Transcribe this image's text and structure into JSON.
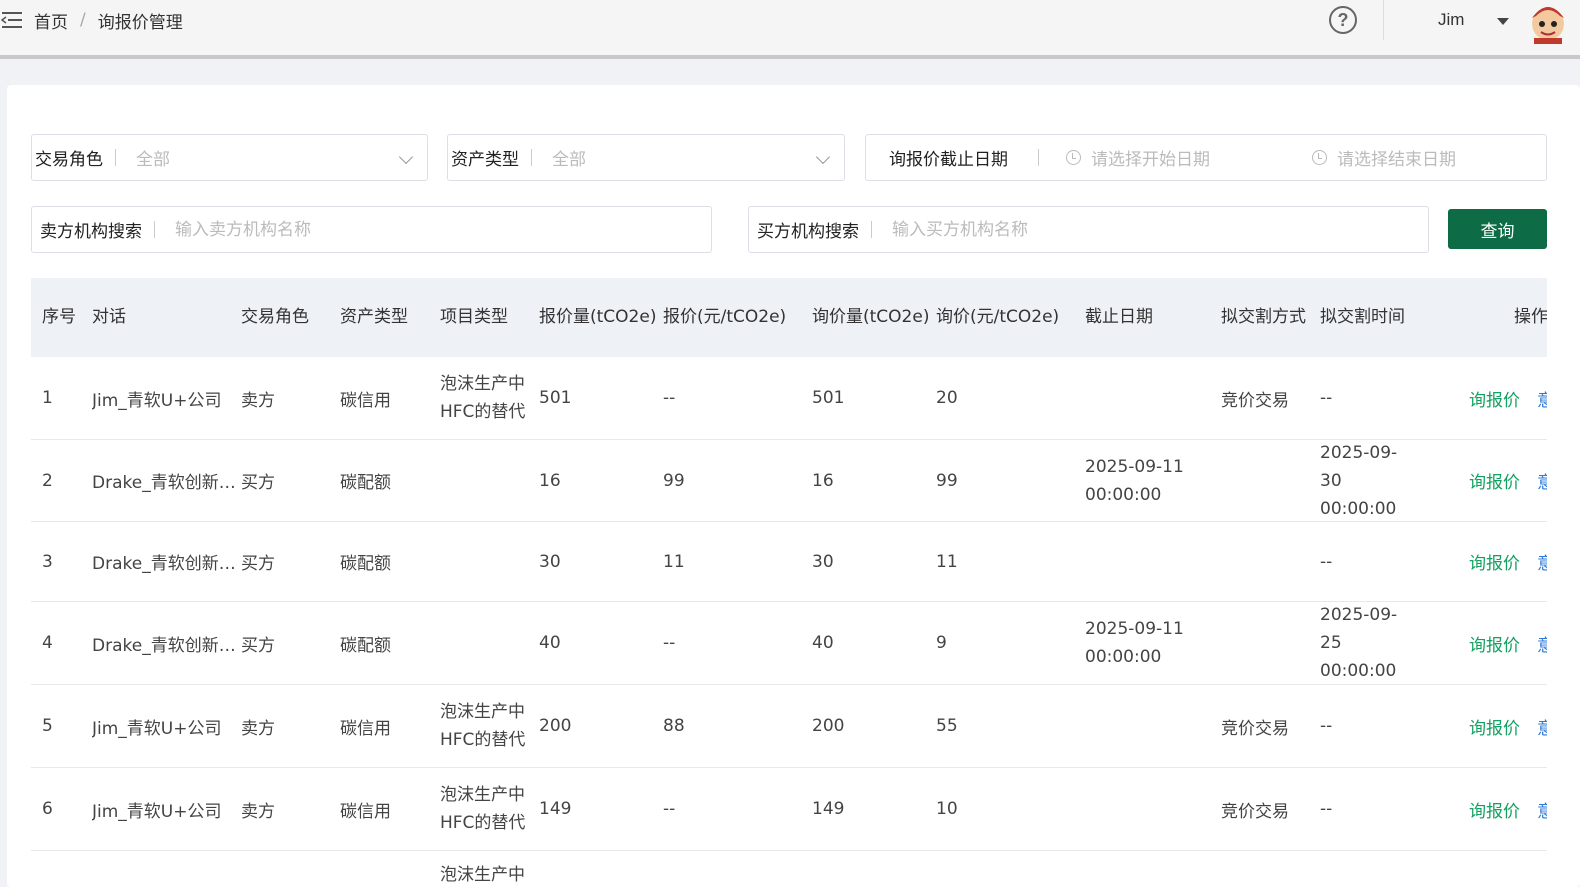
{
  "breadcrumb": {
    "home": "首页",
    "separator": "/",
    "current": "询报价管理"
  },
  "header": {
    "help": "?",
    "user": "Jim"
  },
  "filters": {
    "role": {
      "label": "交易角色",
      "value": "全部"
    },
    "asset": {
      "label": "资产类型",
      "value": "全部"
    },
    "deadline": {
      "label": "询报价截止日期",
      "start_placeholder": "请选择开始日期",
      "end_placeholder": "请选择结束日期"
    },
    "seller": {
      "label": "卖方机构搜索",
      "placeholder": "输入卖方机构名称"
    },
    "buyer": {
      "label": "买方机构搜索",
      "placeholder": "输入买方机构名称"
    },
    "query_button": "查询"
  },
  "table": {
    "headers": [
      "序号",
      "对话",
      "交易角色",
      "资产类型",
      "项目类型",
      "报价量(tCO2e)",
      "报价(元/tCO2e)",
      "询价量(tCO2e)",
      "询价(元/tCO2e)",
      "截止日期",
      "拟交割方式",
      "拟交割时间",
      "操作"
    ],
    "rows": [
      {
        "no": "1",
        "dialog": "Jim_青软U+公司",
        "role": "卖方",
        "asset": "碳信用",
        "project": "泡沫生产中HFC的替代",
        "offer_qty": "501",
        "offer_price": "--",
        "inquiry_qty": "501",
        "inquiry_price": "20",
        "deadline": "",
        "delivery_method": "竞价交易",
        "delivery_time": "--",
        "action": "询报价",
        "action2": "意"
      },
      {
        "no": "2",
        "dialog": "Drake_青软创新科技",
        "role": "买方",
        "asset": "碳配额",
        "project": "",
        "offer_qty": "16",
        "offer_price": "99",
        "inquiry_qty": "16",
        "inquiry_price": "99",
        "deadline": "2025-09-11 00:00:00",
        "delivery_method": "",
        "delivery_time": "2025-09-30 00:00:00",
        "action": "询报价",
        "action2": "意"
      },
      {
        "no": "3",
        "dialog": "Drake_青软创新科技",
        "role": "买方",
        "asset": "碳配额",
        "project": "",
        "offer_qty": "30",
        "offer_price": "11",
        "inquiry_qty": "30",
        "inquiry_price": "11",
        "deadline": "",
        "delivery_method": "",
        "delivery_time": "--",
        "action": "询报价",
        "action2": "意"
      },
      {
        "no": "4",
        "dialog": "Drake_青软创新科技",
        "role": "买方",
        "asset": "碳配额",
        "project": "",
        "offer_qty": "40",
        "offer_price": "--",
        "inquiry_qty": "40",
        "inquiry_price": "9",
        "deadline": "2025-09-11 00:00:00",
        "delivery_method": "",
        "delivery_time": "2025-09-25 00:00:00",
        "action": "询报价",
        "action2": "意"
      },
      {
        "no": "5",
        "dialog": "Jim_青软U+公司",
        "role": "卖方",
        "asset": "碳信用",
        "project": "泡沫生产中HFC的替代",
        "offer_qty": "200",
        "offer_price": "88",
        "inquiry_qty": "200",
        "inquiry_price": "55",
        "deadline": "",
        "delivery_method": "竞价交易",
        "delivery_time": "--",
        "action": "询报价",
        "action2": "意"
      },
      {
        "no": "6",
        "dialog": "Jim_青软U+公司",
        "role": "卖方",
        "asset": "碳信用",
        "project": "泡沫生产中HFC的替代",
        "offer_qty": "149",
        "offer_price": "--",
        "inquiry_qty": "149",
        "inquiry_price": "10",
        "deadline": "",
        "delivery_method": "竞价交易",
        "delivery_time": "--",
        "action": "询报价",
        "action2": "意"
      },
      {
        "no": "",
        "dialog": "",
        "role": "",
        "asset": "",
        "project": "泡沫生产中",
        "offer_qty": "",
        "offer_price": "",
        "inquiry_qty": "",
        "inquiry_price": "",
        "deadline": "",
        "delivery_method": "",
        "delivery_time": "",
        "action": "",
        "action2": ""
      }
    ]
  }
}
